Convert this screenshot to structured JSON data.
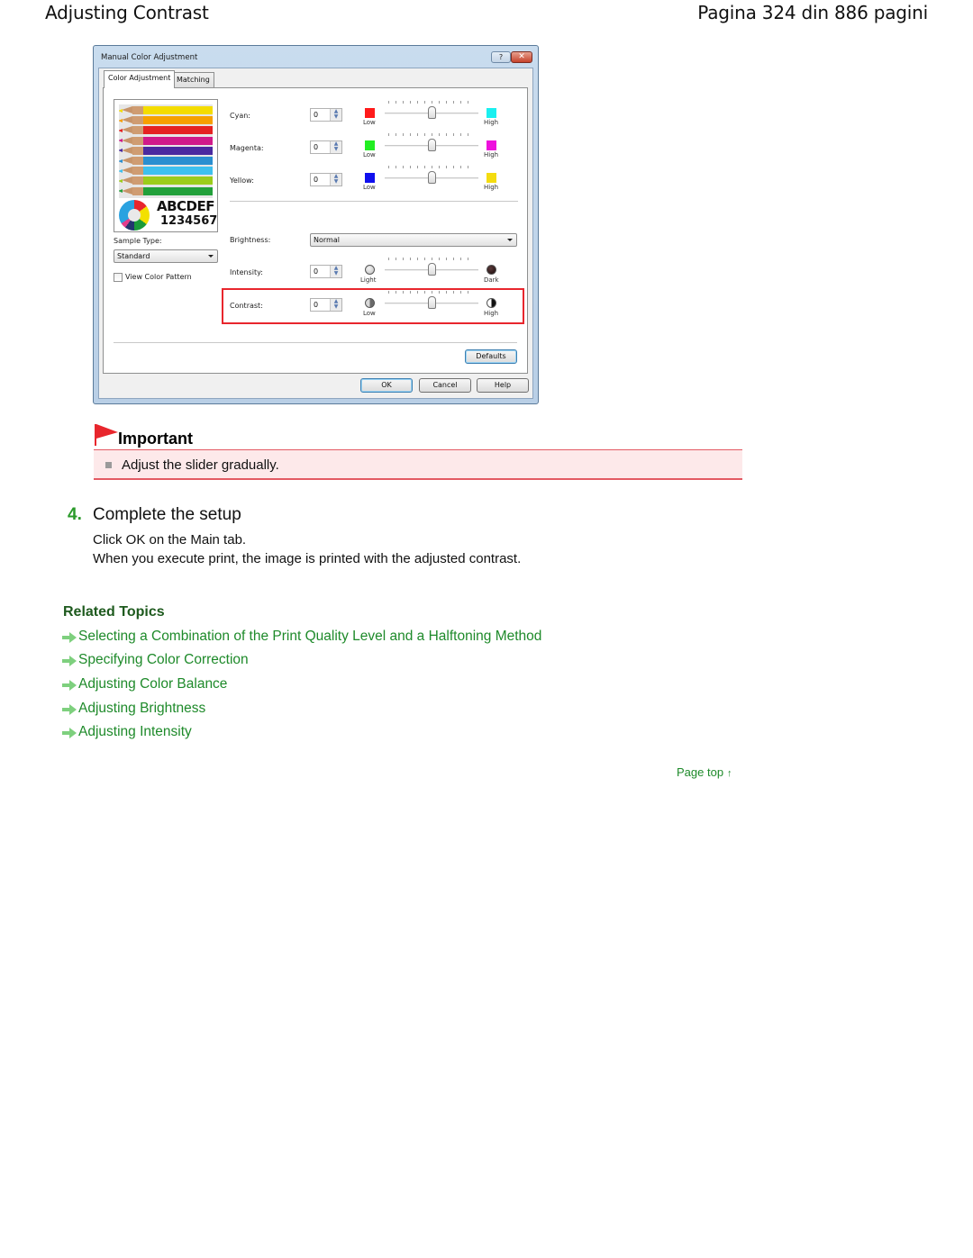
{
  "header": {
    "title": "Adjusting Contrast",
    "page_indicator": "Pagina 324 din 886 pagini"
  },
  "dialog": {
    "title": "Manual Color Adjustment",
    "title_buttons": {
      "help": "?",
      "close": "✕"
    },
    "tabs": [
      {
        "label": "Color Adjustment",
        "active": true
      },
      {
        "label": "Matching",
        "active": false
      }
    ],
    "preview": {
      "sample_text": "ABCDEF",
      "sample_numbers": "1234567",
      "pencil_colors": [
        "#f4dc00",
        "#f6a000",
        "#e52222",
        "#d01a8a",
        "#4a2aa0",
        "#2a8fd0",
        "#3ec0ee",
        "#9ccc1a",
        "#22a03a"
      ]
    },
    "sample_type": {
      "label": "Sample Type:",
      "value": "Standard"
    },
    "view_color_pattern": {
      "label": "View Color Pattern",
      "checked": false
    },
    "rows": [
      {
        "label": "Cyan:",
        "value": "0",
        "low_label": "Low",
        "high_label": "High",
        "low_color": "#ff1a1a",
        "high_color": "#1af0f0",
        "slider_value": 0
      },
      {
        "label": "Magenta:",
        "value": "0",
        "low_label": "Low",
        "high_label": "High",
        "low_color": "#22ee22",
        "high_color": "#ee11dd",
        "slider_value": 0
      },
      {
        "label": "Yellow:",
        "value": "0",
        "low_label": "Low",
        "high_label": "High",
        "low_color": "#1010ee",
        "high_color": "#f4dc10",
        "slider_value": 0
      }
    ],
    "brightness": {
      "label": "Brightness:",
      "value": "Normal"
    },
    "intensity": {
      "label": "Intensity:",
      "value": "0",
      "low_label": "Light",
      "high_label": "Dark",
      "slider_value": 0
    },
    "contrast": {
      "label": "Contrast:",
      "value": "0",
      "low_label": "Low",
      "high_label": "High",
      "slider_value": 0
    },
    "slider_range": [
      -50,
      50
    ],
    "buttons": {
      "defaults": "Defaults",
      "ok": "OK",
      "cancel": "Cancel",
      "help": "Help"
    }
  },
  "important": {
    "title": "Important",
    "items": [
      "Adjust the slider gradually."
    ]
  },
  "step": {
    "number": "4.",
    "title": "Complete the setup",
    "lines": [
      "Click OK on the Main tab.",
      "When you execute print, the image is printed with the adjusted contrast."
    ]
  },
  "related": {
    "title": "Related Topics",
    "links": [
      "Selecting a Combination of the Print Quality Level and a Halftoning Method",
      "Specifying Color Correction",
      "Adjusting Color Balance",
      "Adjusting Brightness",
      "Adjusting Intensity"
    ]
  },
  "page_top": {
    "label": "Page top",
    "icon": "↑"
  },
  "colors": {
    "accent_green": "#1e8a2a",
    "heading_green": "#1e5a1e",
    "important_red": "#e35a63",
    "important_bg": "#fde9ea",
    "highlight_red": "#e8262d"
  }
}
